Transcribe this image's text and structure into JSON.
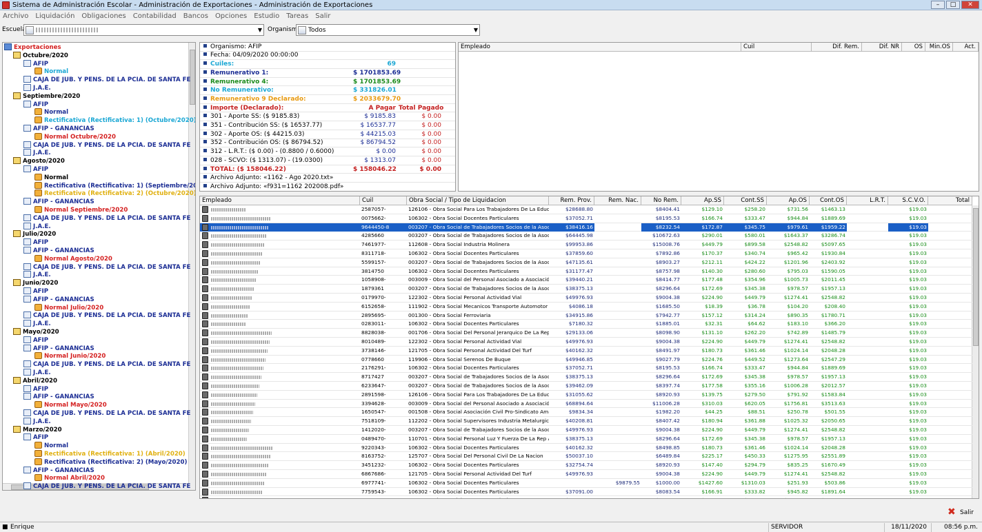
{
  "window": {
    "title": "Sistema de Administración Escolar - Administración de Exportaciones - Administración de Exportaciones"
  },
  "menu": [
    "Archivo",
    "Liquidación",
    "Obligaciones",
    "Contabilidad",
    "Bancos",
    "Opciones",
    "Estudio",
    "Tareas",
    "Salir"
  ],
  "filters": {
    "escuela_label": "Escuela",
    "escuela_value": "",
    "organismo_label": "Organismo",
    "organismo_value": "Todos"
  },
  "tree": [
    {
      "t": "Exportaciones",
      "lvl": 0,
      "c": "#d41f1f",
      "i": "folder"
    },
    {
      "t": "Octubre/2020",
      "lvl": 1,
      "c": "#000",
      "i": "cal"
    },
    {
      "t": "AFIP",
      "lvl": 2,
      "c": "#1b2d94",
      "i": "doc"
    },
    {
      "t": "Normal",
      "lvl": 3,
      "c": "#1aa7d4",
      "i": "warn"
    },
    {
      "t": "CAJA DE JUB. Y PENS. DE LA PCIA. DE SANTA FE",
      "lvl": 2,
      "c": "#1b2d94",
      "i": "doc"
    },
    {
      "t": "J.A.E.",
      "lvl": 2,
      "c": "#1b2d94",
      "i": "doc"
    },
    {
      "t": "Septiembre/2020",
      "lvl": 1,
      "c": "#000",
      "i": "cal"
    },
    {
      "t": "AFIP",
      "lvl": 2,
      "c": "#1b2d94",
      "i": "doc"
    },
    {
      "t": "Normal",
      "lvl": 3,
      "c": "#1b2d94",
      "i": "warn"
    },
    {
      "t": "Rectificativa (Rectificativa: 1) (Octubre/2020)",
      "lvl": 3,
      "c": "#1aa7d4",
      "i": "warn"
    },
    {
      "t": "AFIP - GANANCIAS",
      "lvl": 2,
      "c": "#1b2d94",
      "i": "doc"
    },
    {
      "t": "Normal Octubre/2020",
      "lvl": 3,
      "c": "#d41f1f",
      "i": "warn"
    },
    {
      "t": "CAJA DE JUB. Y PENS. DE LA PCIA. DE SANTA FE",
      "lvl": 2,
      "c": "#1b2d94",
      "i": "doc"
    },
    {
      "t": "J.A.E.",
      "lvl": 2,
      "c": "#1b2d94",
      "i": "doc"
    },
    {
      "t": "Agosto/2020",
      "lvl": 1,
      "c": "#000",
      "i": "cal"
    },
    {
      "t": "AFIP",
      "lvl": 2,
      "c": "#1b2d94",
      "i": "doc"
    },
    {
      "t": "Normal",
      "lvl": 3,
      "c": "#000",
      "i": "warn"
    },
    {
      "t": "Rectificativa (Rectificativa: 1) (Septiembre/2020)",
      "lvl": 3,
      "c": "#1b2d94",
      "i": "warn"
    },
    {
      "t": "Rectificativa (Rectificativa: 2) (Octubre/2020)",
      "lvl": 3,
      "c": "#e0b010",
      "i": "warn"
    },
    {
      "t": "AFIP - GANANCIAS",
      "lvl": 2,
      "c": "#1b2d94",
      "i": "doc"
    },
    {
      "t": "Normal Septiembre/2020",
      "lvl": 3,
      "c": "#d41f1f",
      "i": "warn"
    },
    {
      "t": "CAJA DE JUB. Y PENS. DE LA PCIA. DE SANTA FE",
      "lvl": 2,
      "c": "#1b2d94",
      "i": "doc"
    },
    {
      "t": "J.A.E.",
      "lvl": 2,
      "c": "#1b2d94",
      "i": "doc"
    },
    {
      "t": "Julio/2020",
      "lvl": 1,
      "c": "#000",
      "i": "cal"
    },
    {
      "t": "AFIP",
      "lvl": 2,
      "c": "#1b2d94",
      "i": "doc"
    },
    {
      "t": "AFIP - GANANCIAS",
      "lvl": 2,
      "c": "#1b2d94",
      "i": "doc"
    },
    {
      "t": "Normal Agosto/2020",
      "lvl": 3,
      "c": "#d41f1f",
      "i": "warn"
    },
    {
      "t": "CAJA DE JUB. Y PENS. DE LA PCIA. DE SANTA FE",
      "lvl": 2,
      "c": "#1b2d94",
      "i": "doc"
    },
    {
      "t": "J.A.E.",
      "lvl": 2,
      "c": "#1b2d94",
      "i": "doc"
    },
    {
      "t": "Junio/2020",
      "lvl": 1,
      "c": "#000",
      "i": "cal"
    },
    {
      "t": "AFIP",
      "lvl": 2,
      "c": "#1b2d94",
      "i": "doc"
    },
    {
      "t": "AFIP - GANANCIAS",
      "lvl": 2,
      "c": "#1b2d94",
      "i": "doc"
    },
    {
      "t": "Normal Julio/2020",
      "lvl": 3,
      "c": "#d41f1f",
      "i": "warn"
    },
    {
      "t": "CAJA DE JUB. Y PENS. DE LA PCIA. DE SANTA FE",
      "lvl": 2,
      "c": "#1b2d94",
      "i": "doc"
    },
    {
      "t": "J.A.E.",
      "lvl": 2,
      "c": "#1b2d94",
      "i": "doc"
    },
    {
      "t": "Mayo/2020",
      "lvl": 1,
      "c": "#000",
      "i": "cal"
    },
    {
      "t": "AFIP",
      "lvl": 2,
      "c": "#1b2d94",
      "i": "doc"
    },
    {
      "t": "AFIP - GANANCIAS",
      "lvl": 2,
      "c": "#1b2d94",
      "i": "doc"
    },
    {
      "t": "Normal Junio/2020",
      "lvl": 3,
      "c": "#d41f1f",
      "i": "warn"
    },
    {
      "t": "CAJA DE JUB. Y PENS. DE LA PCIA. DE SANTA FE",
      "lvl": 2,
      "c": "#1b2d94",
      "i": "doc"
    },
    {
      "t": "J.A.E.",
      "lvl": 2,
      "c": "#1b2d94",
      "i": "doc"
    },
    {
      "t": "Abril/2020",
      "lvl": 1,
      "c": "#000",
      "i": "cal"
    },
    {
      "t": "AFIP",
      "lvl": 2,
      "c": "#1b2d94",
      "i": "doc"
    },
    {
      "t": "AFIP - GANANCIAS",
      "lvl": 2,
      "c": "#1b2d94",
      "i": "doc"
    },
    {
      "t": "Normal Mayo/2020",
      "lvl": 3,
      "c": "#d41f1f",
      "i": "warn"
    },
    {
      "t": "CAJA DE JUB. Y PENS. DE LA PCIA. DE SANTA FE",
      "lvl": 2,
      "c": "#1b2d94",
      "i": "doc"
    },
    {
      "t": "J.A.E.",
      "lvl": 2,
      "c": "#1b2d94",
      "i": "doc"
    },
    {
      "t": "Marzo/2020",
      "lvl": 1,
      "c": "#000",
      "i": "cal"
    },
    {
      "t": "AFIP",
      "lvl": 2,
      "c": "#1b2d94",
      "i": "doc"
    },
    {
      "t": "Normal",
      "lvl": 3,
      "c": "#1b2d94",
      "i": "warn"
    },
    {
      "t": "Rectificativa (Rectificativa: 1) (Abril/2020)",
      "lvl": 3,
      "c": "#e0b010",
      "i": "warn"
    },
    {
      "t": "Rectificativa (Rectificativa: 2) (Mayo/2020)",
      "lvl": 3,
      "c": "#1b2d94",
      "i": "warn"
    },
    {
      "t": "AFIP - GANANCIAS",
      "lvl": 2,
      "c": "#1b2d94",
      "i": "doc"
    },
    {
      "t": "Normal Abril/2020",
      "lvl": 3,
      "c": "#d41f1f",
      "i": "warn"
    },
    {
      "t": "CAJA DE JUB. Y PENS. DE LA PCIA. DE SANTA FE",
      "lvl": 2,
      "c": "#1b2d94",
      "i": "doc"
    }
  ],
  "summary": [
    {
      "l": "Organismo: AFIP",
      "a": "",
      "b": "",
      "c": "#000",
      "bold": false,
      "icon": "dot"
    },
    {
      "l": "Fecha: 04/09/2020 00:00:00",
      "a": "",
      "b": "",
      "c": "#000",
      "bold": false,
      "icon": "dot"
    },
    {
      "l": "Cuiles:",
      "a": "69",
      "b": "",
      "c": "#1aa7d4",
      "bold": true,
      "icon": "dot"
    },
    {
      "l": "Remunerativo 1:",
      "a": "$ 1701853.69",
      "b": "",
      "c": "#1b2d94",
      "bold": true,
      "icon": "dot"
    },
    {
      "l": "Remunerativo 4:",
      "a": "$ 1701853.69",
      "b": "",
      "c": "#1a8a1a",
      "bold": true,
      "icon": "dot"
    },
    {
      "l": "No Remunerativo:",
      "a": "$ 331826.01",
      "b": "",
      "c": "#1aa7d4",
      "bold": true,
      "icon": "dot"
    },
    {
      "l": "Remunerativo 9 Declarado:",
      "a": "$ 2033679.70",
      "b": "",
      "c": "#e89a10",
      "bold": true,
      "icon": "dot"
    },
    {
      "l": "Importe (Declarado):",
      "a": "A Pagar",
      "b": "Total Pagado",
      "c": "#c41f1f",
      "bold": true,
      "icon": "dot"
    },
    {
      "l": "301 - Aporte SS:  ($ 9185.83)",
      "a": "$ 9185.83",
      "b": "$ 0.00",
      "c": "#000",
      "bold": false,
      "icon": "dot"
    },
    {
      "l": "351 - Contribución SS:  ($ 16537.77)",
      "a": "$ 16537.77",
      "b": "$ 0.00",
      "c": "#000",
      "bold": false,
      "icon": "dot"
    },
    {
      "l": "302 - Aporte OS:  ($ 44215.03)",
      "a": "$ 44215.03",
      "b": "$ 0.00",
      "c": "#000",
      "bold": false,
      "icon": "dot"
    },
    {
      "l": "352 - Contribución OS:  ($ 86794.52)",
      "a": "$ 86794.52",
      "b": "$ 0.00",
      "c": "#000",
      "bold": false,
      "icon": "dot"
    },
    {
      "l": "312 - L.R.T.:  ($ 0.00) - (0.8800 / 0.6000)",
      "a": "$ 0.00",
      "b": "$ 0.00",
      "c": "#000",
      "bold": false,
      "icon": "dot"
    },
    {
      "l": "028 - SCVO:  ($ 1313.07) - (19.0300)",
      "a": "$ 1313.07",
      "b": "$ 0.00",
      "c": "#000",
      "bold": false,
      "icon": "dot"
    },
    {
      "l": "TOTAL:  ($ 158046.22)",
      "a": "$ 158046.22",
      "b": "$ 0.00",
      "c": "#c41f1f",
      "bold": true,
      "icon": "dot"
    },
    {
      "l": "Archivo Adjunto: «1162 - Ago 2020.txt»",
      "a": "",
      "b": "",
      "c": "#000",
      "bold": false,
      "icon": "clip"
    },
    {
      "l": "Archivo Adjunto: «f931=1162 202008.pdf»",
      "a": "",
      "b": "",
      "c": "#000",
      "bold": false,
      "icon": "clip"
    }
  ],
  "top_grid_headers": [
    "Empleado",
    "Cuil",
    "Dif. Rem.",
    "Dif. NR",
    "OS",
    "Min.OS",
    "Act."
  ],
  "grid_headers": [
    "Empleado",
    "Cuil",
    "Obra Social / Tipo de Liquidacion",
    "Rem. Prov.",
    "Rem. Nac.",
    "No Rem.",
    "Ap.SS",
    "Cont.SS",
    "Ap.OS",
    "Cont.OS",
    "L.R.T.",
    "S.C.V.O.",
    "Total"
  ],
  "grid_rows": [
    [
      "",
      "2587057-",
      "126106 - Obra Social Para Los Trabajadores De La Educación ...",
      "$28688.80",
      "",
      "$8404.41",
      "$129.10",
      "$258.20",
      "$731.56",
      "$1463.13",
      "",
      "$19.03",
      ""
    ],
    [
      "",
      "0075662-",
      "106302 - Obra Social Docentes Particulares",
      "$37052.71",
      "",
      "$8195.53",
      "$166.74",
      "$333.47",
      "$944.84",
      "$1889.69",
      "",
      "$19.03",
      ""
    ],
    [
      "",
      "9644450-8",
      "003207 - Obra Social de Trabajadores Socios de la Asociación ...",
      "$38416.16",
      "",
      "$8232.54",
      "$172.87",
      "$345.75",
      "$979.61",
      "$1959.22",
      "",
      "$19.03",
      ""
    ],
    [
      "",
      "4285660",
      "003207 - Obra Social de Trabajadores Socios de la Asociación ...",
      "$64445.98",
      "",
      "$10672.63",
      "$290.01",
      "$580.01",
      "$1643.37",
      "$3286.74",
      "",
      "$19.03",
      ""
    ],
    [
      "",
      "7461977-",
      "112608 - Obra Social Industria Molinera",
      "$99953.86",
      "",
      "$15008.76",
      "$449.79",
      "$899.58",
      "$2548.82",
      "$5097.65",
      "",
      "$19.03",
      ""
    ],
    [
      "",
      "8311718-",
      "106302 - Obra Social Docentes Particulares",
      "$37859.60",
      "",
      "$7892.86",
      "$170.37",
      "$340.74",
      "$965.42",
      "$1930.84",
      "",
      "$19.03",
      ""
    ],
    [
      "",
      "5599157-",
      "003207 - Obra Social de Trabajadores Socios de la Asociación ...",
      "$47135.61",
      "",
      "$8903.27",
      "$212.11",
      "$424.22",
      "$1201.96",
      "$2403.92",
      "",
      "$19.03",
      ""
    ],
    [
      "",
      "3814750",
      "106302 - Obra Social Docentes Particulares",
      "$31177.47",
      "",
      "$8757.98",
      "$140.30",
      "$280.60",
      "$795.03",
      "$1590.05",
      "",
      "$19.03",
      ""
    ],
    [
      "",
      "1058908-",
      "003009 - Obra Social del Personal Asociado a Asociación Mutu...",
      "$39440.21",
      "",
      "$8414.77",
      "$177.48",
      "$354.96",
      "$1005.73",
      "$2011.45",
      "",
      "$19.03",
      ""
    ],
    [
      "",
      "1879361",
      "003207 - Obra Social de Trabajadores Socios de la Asociación ...",
      "$38375.13",
      "",
      "$8296.64",
      "$172.69",
      "$345.38",
      "$978.57",
      "$1957.13",
      "",
      "$19.03",
      ""
    ],
    [
      "",
      "0179970-",
      "122302 - Obra Social Personal Actividad Vial",
      "$49976.93",
      "",
      "$9004.38",
      "$224.90",
      "$449.79",
      "$1274.41",
      "$2548.82",
      "",
      "$19.03",
      ""
    ],
    [
      "",
      "6152658-",
      "111902 - Obra Social Mecanicos Transporte Automotor",
      "$4086.18",
      "",
      "$1685.50",
      "$18.39",
      "$36.78",
      "$104.20",
      "$208.40",
      "",
      "$19.03",
      ""
    ],
    [
      "",
      "2895695-",
      "001300 - Obra Social Ferroviaria",
      "$34915.86",
      "",
      "$7942.77",
      "$157.12",
      "$314.24",
      "$890.35",
      "$1780.71",
      "",
      "$19.03",
      ""
    ],
    [
      "",
      "0283011-",
      "106302 - Obra Social Docentes Particulares",
      "$7180.32",
      "",
      "$1885.01",
      "$32.31",
      "$64.62",
      "$183.10",
      "$366.20",
      "",
      "$19.03",
      ""
    ],
    [
      "",
      "8828038-",
      "001706 - Obra Social Del Personal Jerarquico De La Republica ...",
      "$29133.06",
      "",
      "$8098.90",
      "$131.10",
      "$262.20",
      "$742.89",
      "$1485.79",
      "",
      "$19.03",
      ""
    ],
    [
      "",
      "8010489-",
      "122302 - Obra Social Personal Actividad Vial",
      "$49976.93",
      "",
      "$9004.38",
      "$224.90",
      "$449.79",
      "$1274.41",
      "$2548.82",
      "",
      "$19.03",
      ""
    ],
    [
      "",
      "3738146-",
      "121705 - Obra Social Personal Actividad Del Turf",
      "$40162.32",
      "",
      "$8491.97",
      "$180.73",
      "$361.46",
      "$1024.14",
      "$2048.28",
      "",
      "$19.03",
      ""
    ],
    [
      "",
      "0778660",
      "119906 - Obra Social Serenos De Buque",
      "$49946.85",
      "",
      "$9027.79",
      "$224.76",
      "$449.52",
      "$1273.64",
      "$2547.29",
      "",
      "$19.03",
      ""
    ],
    [
      "",
      "2176291-",
      "106302 - Obra Social Docentes Particulares",
      "$37052.71",
      "",
      "$8195.53",
      "$166.74",
      "$333.47",
      "$944.84",
      "$1889.69",
      "",
      "$19.03",
      ""
    ],
    [
      "",
      "8717427",
      "003207 - Obra Social de Trabajadores Socios de la Asociación ...",
      "$38375.13",
      "",
      "$8296.64",
      "$172.69",
      "$345.38",
      "$978.57",
      "$1957.13",
      "",
      "$19.03",
      ""
    ],
    [
      "",
      "6233647-",
      "003207 - Obra Social de Trabajadores Socios de la Asociación ...",
      "$39462.09",
      "",
      "$8397.74",
      "$177.58",
      "$355.16",
      "$1006.28",
      "$2012.57",
      "",
      "$19.03",
      ""
    ],
    [
      "",
      "2891598-",
      "126106 - Obra Social Para Los Trabajadores De La Educación ...",
      "$31055.62",
      "",
      "$8920.93",
      "$139.75",
      "$279.50",
      "$791.92",
      "$1583.84",
      "",
      "$19.03",
      ""
    ],
    [
      "",
      "3394628-",
      "003009 - Obra Social del Personal Asociado a Asociación Mutu...",
      "$68894.64",
      "",
      "$11006.28",
      "$310.03",
      "$620.05",
      "$1756.81",
      "$3513.63",
      "",
      "$19.03",
      ""
    ],
    [
      "",
      "1650547-",
      "001508 - Obra Social Asociación Civil Pro-Sindicato Amas de ...",
      "$9834.34",
      "",
      "$1982.20",
      "$44.25",
      "$88.51",
      "$250.78",
      "$501.55",
      "",
      "$19.03",
      ""
    ],
    [
      "",
      "7518109-",
      "112202 - Obra Social Supervisores Industria Metalurgica",
      "$40208.81",
      "",
      "$8407.42",
      "$180.94",
      "$361.88",
      "$1025.32",
      "$2050.65",
      "",
      "$19.03",
      ""
    ],
    [
      "",
      "1412020-",
      "003207 - Obra Social de Trabajadores Socios de la Asociación ...",
      "$49976.93",
      "",
      "$9004.38",
      "$224.90",
      "$449.79",
      "$1274.41",
      "$2548.82",
      "",
      "$19.03",
      ""
    ],
    [
      "",
      "0489470-",
      "110701 - Obra Social Personal Luz Y Fuerza De La Rep Argent...",
      "$38375.13",
      "",
      "$8296.64",
      "$172.69",
      "$345.38",
      "$978.57",
      "$1957.13",
      "",
      "$19.03",
      ""
    ],
    [
      "",
      "9220343-",
      "106302 - Obra Social Docentes Particulares",
      "$40162.32",
      "",
      "$8498.85",
      "$180.73",
      "$361.46",
      "$1024.14",
      "$2048.28",
      "",
      "$19.03",
      ""
    ],
    [
      "",
      "8163752-",
      "125707 - Obra Social Del Personal Civil De La Nacion",
      "$50037.10",
      "",
      "$6489.84",
      "$225.17",
      "$450.33",
      "$1275.95",
      "$2551.89",
      "",
      "$19.03",
      ""
    ],
    [
      "",
      "3451232-",
      "106302 - Obra Social Docentes Particulares",
      "$32754.74",
      "",
      "$8920.93",
      "$147.40",
      "$294.79",
      "$835.25",
      "$1670.49",
      "",
      "$19.03",
      ""
    ],
    [
      "",
      "6867686-",
      "121705 - Obra Social Personal Actividad Del Turf",
      "$49976.93",
      "",
      "$9004.38",
      "$224.90",
      "$449.79",
      "$1274.41",
      "$2548.82",
      "",
      "$19.03",
      ""
    ],
    [
      "",
      "6977741-",
      "106302 - Obra Social Docentes Particulares",
      "",
      "$9879.55",
      "$1000.00",
      "$1427.60",
      "$1310.03",
      "$251.93",
      "$503.86",
      "",
      "$19.03",
      ""
    ],
    [
      "",
      "7759543-",
      "106302 - Obra Social Docentes Particulares",
      "$37091.00",
      "",
      "$8083.54",
      "$166.91",
      "$333.82",
      "$945.82",
      "$1891.64",
      "",
      "$19.03",
      ""
    ],
    [
      "",
      "8158224-",
      "106302 - Obra Social Docentes Particulares",
      "$39440.21",
      "",
      "$8414.77",
      "$177.48",
      "$354.96",
      "$1005.73",
      "$2011.45",
      "",
      "$19.03",
      ""
    ]
  ],
  "selected_row": 2,
  "footer": {
    "salir_label": "Salir"
  },
  "status": {
    "user": "Enrique",
    "server": "SERVIDOR",
    "date": "18/11/2020",
    "time": "08:56 p.m."
  }
}
